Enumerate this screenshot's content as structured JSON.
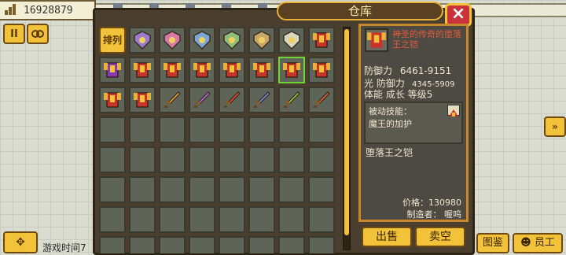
{
  "hud": {
    "money": "16928879",
    "money_icon": "building-chart-icon",
    "pause_label": "II",
    "game_time": "游戏时间7"
  },
  "warehouse": {
    "title": "仓库",
    "close": "×",
    "sort_label": "排列",
    "selected_index": 13,
    "items": [
      {
        "kind": "shield",
        "color": "#9a7bd0"
      },
      {
        "kind": "shield",
        "color": "#d879a8"
      },
      {
        "kind": "shield",
        "color": "#7aa6d8"
      },
      {
        "kind": "shield",
        "color": "#8fc07a"
      },
      {
        "kind": "shield",
        "color": "#c8a868"
      },
      {
        "kind": "shield",
        "color": "#d8d8c0"
      },
      {
        "kind": "armor",
        "color": "#c8342a"
      },
      {
        "kind": "armor",
        "color": "#8a3ab0"
      },
      {
        "kind": "armor",
        "color": "#c8342a"
      },
      {
        "kind": "armor",
        "color": "#c8342a"
      },
      {
        "kind": "armor",
        "color": "#c8342a"
      },
      {
        "kind": "armor",
        "color": "#c8342a"
      },
      {
        "kind": "armor",
        "color": "#c8342a"
      },
      {
        "kind": "armor",
        "color": "#c8342a"
      },
      {
        "kind": "armor",
        "color": "#c8342a"
      },
      {
        "kind": "armor",
        "color": "#c8342a"
      },
      {
        "kind": "armor",
        "color": "#c8342a"
      },
      {
        "kind": "sword",
        "color": "#e0a040"
      },
      {
        "kind": "sword",
        "color": "#b070d8"
      },
      {
        "kind": "sword",
        "color": "#e05038"
      },
      {
        "kind": "sword",
        "color": "#7a8ad8"
      },
      {
        "kind": "sword",
        "color": "#9ac040"
      },
      {
        "kind": "sword",
        "color": "#d8683a"
      }
    ]
  },
  "detail": {
    "name": "神圣的传奇的堕落王之铠",
    "defense_label": "防御力",
    "defense_value": "6461-9151",
    "light_defense_label": "光 防御力",
    "light_defense_value": "4345-5909",
    "attrs": "体能  成长  等级5",
    "passive_label": "被动技能：",
    "passive_value": "魔王的加护",
    "item_name": "堕落王之铠",
    "price": "价格：130980",
    "maker": "制造者： 喔呜"
  },
  "actions": {
    "sell": "出售",
    "sell_empty": "卖空"
  },
  "side": {
    "next_label": "»",
    "gallery": "图鉴",
    "staff": "员工",
    "move_label": "✥"
  },
  "colors": {
    "gold": "#f2c23a",
    "panel": "#4a3e2e",
    "frame": "#c9882a",
    "red": "#c9323a",
    "highlight": "#6fd63a"
  }
}
